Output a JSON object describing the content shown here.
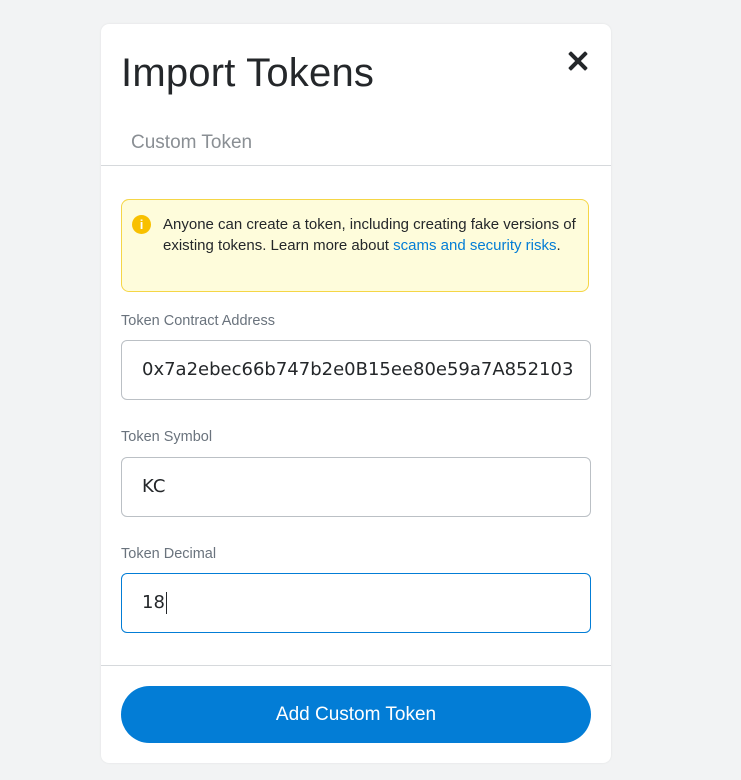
{
  "modal": {
    "title": "Import Tokens",
    "close_icon": "close-icon"
  },
  "tabs": [
    {
      "label": "Custom Token",
      "active": true
    }
  ],
  "warning": {
    "icon": "info-icon",
    "icon_glyph": "i",
    "text": "Anyone can create a token, including creating fake versions of existing tokens. Learn more about ",
    "link_text": "scams and security risks",
    "suffix": "."
  },
  "fields": {
    "contract_address": {
      "label": "Token Contract Address",
      "value": "0x7a2ebec66b747b2e0B15ee80e59a7A852103"
    },
    "symbol": {
      "label": "Token Symbol",
      "value": "KC"
    },
    "decimal": {
      "label": "Token Decimal",
      "value": "18"
    }
  },
  "actions": {
    "add_label": "Add Custom Token"
  },
  "colors": {
    "accent": "#037dd6",
    "warning_bg": "#fefcdb",
    "warning_border": "#f5d646",
    "warning_icon": "#f8c000",
    "page_bg": "#f2f3f4"
  }
}
